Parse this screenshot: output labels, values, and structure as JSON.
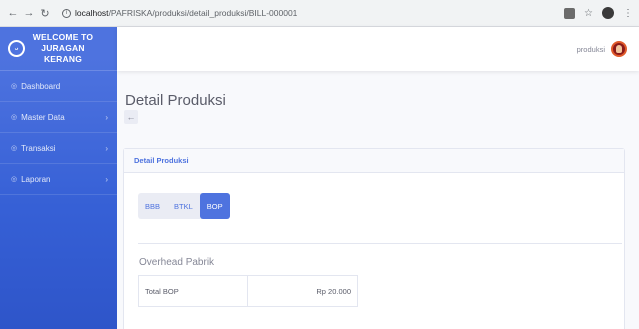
{
  "browser": {
    "url_host": "localhost",
    "url_path": "/PAFRISKA/produksi/detail_produksi/BILL-000001"
  },
  "sidebar": {
    "brand_lines": [
      "WELCOME TO",
      "JURAGAN",
      "KERANG"
    ],
    "items": [
      {
        "label": "Dashboard",
        "has_chevron": false
      },
      {
        "label": "Master Data",
        "has_chevron": true
      },
      {
        "label": "Transaksi",
        "has_chevron": true
      },
      {
        "label": "Laporan",
        "has_chevron": true
      }
    ],
    "chevron": "›",
    "bullet": "◎"
  },
  "topbar": {
    "user_name": "produksi"
  },
  "main": {
    "page_title": "Detail Produksi",
    "back_icon": "←",
    "card_title": "Detail Produksi",
    "tabs": [
      {
        "label": "BBB",
        "active": false
      },
      {
        "label": "BTKL",
        "active": false
      },
      {
        "label": "BOP",
        "active": true
      }
    ],
    "section_title": "Overhead Pabrik",
    "table": [
      {
        "label": "Total BOP",
        "value": "Rp 20.000"
      }
    ]
  },
  "colors": {
    "primary": "#4e73df",
    "sidebar_bottom": "#2e55c9",
    "text_muted": "#858796"
  }
}
